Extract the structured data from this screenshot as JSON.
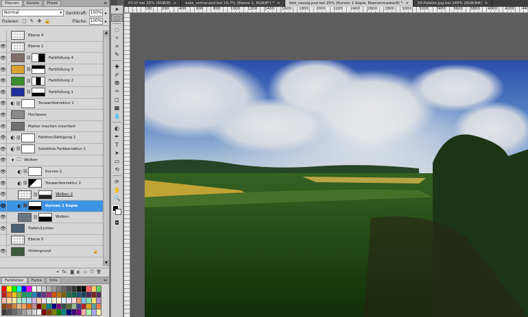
{
  "layers_panel": {
    "tabs": [
      "Ebenen",
      "Kanäle",
      "Pfade"
    ],
    "menu_icon": "panel-menu-icon",
    "blend_mode": "Normal",
    "opacity_label": "Deckkraft:",
    "opacity_value": "100%",
    "lock_label": "Fixieren:",
    "fill_label": "Fläche:",
    "fill_value": "100%",
    "layers": [
      {
        "name": "Ebene 4",
        "visible": false,
        "indent": 0,
        "thumb": "checker",
        "style": ""
      },
      {
        "name": "Ebene 1",
        "visible": true,
        "indent": 0,
        "thumb": "checker",
        "style": ""
      },
      {
        "name": "Farbfüllung 4",
        "visible": true,
        "indent": 0,
        "thumb": "#7e6e6a",
        "mask": "mask-a",
        "style": ""
      },
      {
        "name": "Farbfüllung 3",
        "visible": true,
        "indent": 0,
        "thumb": "#d8a531",
        "mask": "mask-b",
        "style": ""
      },
      {
        "name": "Farbfüllung 2",
        "visible": true,
        "indent": 0,
        "thumb": "#3a8f2c",
        "mask": "mask-c",
        "style": ""
      },
      {
        "name": "Farbfüllung 1",
        "visible": true,
        "indent": 0,
        "thumb": "#1b2f9d",
        "mask": "mask-d",
        "style": ""
      },
      {
        "name": "Tonwertkorrektur 1",
        "visible": true,
        "indent": 0,
        "adj": true,
        "mask": "white",
        "style": ""
      },
      {
        "name": "Hochpass",
        "visible": true,
        "indent": 0,
        "thumb": "#8a8a8a",
        "style": ""
      },
      {
        "name": "Matter machen invertiert",
        "visible": true,
        "indent": 0,
        "thumb": "#707070",
        "style": ""
      },
      {
        "name": "Farbton/Sättigung 1",
        "visible": true,
        "indent": 0,
        "adj": true,
        "mask": "white",
        "style": ""
      },
      {
        "name": "Selektive Farbkorrektur 1",
        "visible": true,
        "indent": 0,
        "adj": true,
        "mask": "white",
        "style": ""
      },
      {
        "name": "Wolken",
        "visible": true,
        "indent": 0,
        "group": true,
        "style": ""
      },
      {
        "name": "Kurven 1",
        "visible": true,
        "indent": 1,
        "adj": true,
        "mask": "white",
        "style": ""
      },
      {
        "name": "Tonwertkorrektur 2",
        "visible": true,
        "indent": 1,
        "adj": true,
        "mask": "mask-e",
        "style": ""
      },
      {
        "name": "Wolken 2",
        "visible": true,
        "indent": 1,
        "thumb": "checker",
        "mask": "mask-f",
        "style": "u"
      },
      {
        "name": "Kurven 1 Kopie",
        "visible": true,
        "indent": 1,
        "adj": true,
        "mask": "mask-g",
        "selected": true,
        "style": ""
      },
      {
        "name": "Wolken",
        "visible": true,
        "indent": 1,
        "thumb": "#6a7580",
        "mask": "mask-h",
        "style": ""
      },
      {
        "name": "Tiefen/Lichter",
        "visible": true,
        "indent": 0,
        "thumb": "#4a6074",
        "style": ""
      },
      {
        "name": "Ebene 5",
        "visible": false,
        "indent": 0,
        "thumb": "checker",
        "style": ""
      },
      {
        "name": "Hintergrund",
        "visible": true,
        "indent": 0,
        "thumb": "#3c5a3a",
        "style": "it",
        "locked": true
      }
    ],
    "bottom_icons": [
      "link-icon",
      "fx-icon",
      "mask-icon",
      "adjust-icon",
      "folder-icon",
      "new-layer-icon",
      "trash-icon"
    ]
  },
  "swatches_panel": {
    "tabs": [
      "Farbfelder",
      "Farbe",
      "Stile"
    ],
    "colors": [
      "#ff0000",
      "#ffff00",
      "#00ff00",
      "#00ffff",
      "#0000ff",
      "#ff00ff",
      "#ffffff",
      "#e6e6e6",
      "#cccccc",
      "#b3b3b3",
      "#999999",
      "#808080",
      "#666666",
      "#4d4d4d",
      "#333333",
      "#1a1a1a",
      "#000000",
      "#ff6666",
      "#ffcc66",
      "#66cc66",
      "#c21a1a",
      "#e67e22",
      "#f1c40f",
      "#7dbb3c",
      "#1e9b5a",
      "#16a085",
      "#2980b9",
      "#2c3e90",
      "#6c3483",
      "#a5296f",
      "#d35400",
      "#b9770e",
      "#7d6608",
      "#1d6f42",
      "#0e6655",
      "#1b4f72",
      "#154360",
      "#4a235a",
      "#78281f",
      "#512e5f",
      "#f5b7b1",
      "#fad7a0",
      "#f9e79f",
      "#abebc6",
      "#a3e4d7",
      "#aed6f1",
      "#d2b4de",
      "#f5cba7",
      "#e8daef",
      "#d5f5e3",
      "#fdebd0",
      "#fcf3cf",
      "#d6eaf8",
      "#ebdef0",
      "#fadbd8",
      "#e59866",
      "#85c1e9",
      "#82e0aa",
      "#f7dc6f",
      "#bb8fce",
      "#8b4513",
      "#a0522d",
      "#cd853f",
      "#deb887",
      "#f4a460",
      "#d2691e",
      "#bc8f8f",
      "#800000",
      "#808000",
      "#008080",
      "#000080",
      "#800080",
      "#2f4f4f",
      "#556b2f",
      "#8fbc8f",
      "#483d8b",
      "#b22222",
      "#daa520",
      "#5f9ea0",
      "#ff7f50",
      "#3a3a3a",
      "#505050",
      "#6a6a6a",
      "#858585",
      "#a0a0a0",
      "#bababa",
      "#d4d4d4",
      "#efefef",
      "#7f0000",
      "#7f3f00",
      "#7f7f00",
      "#007f00",
      "#007f7f",
      "#00007f",
      "#3f007f",
      "#7f007f",
      "#ffaaaa",
      "#aaffaa",
      "#aaaaff",
      "#ffffaa"
    ]
  },
  "document_tabs": [
    {
      "label": "03.tif bei 25% (RGB/8)",
      "active": false
    },
    {
      "label": "kate_vorher.psd bei 16,7% (Ebene 1, RGB/8*) *",
      "active": false
    },
    {
      "label": "feld_nassig.psd bei 25% (Kurven 1 Kopie, Ebenenmaske/8) *",
      "active": false
    },
    {
      "label": "05-Palette.jpg bei 189% (RGB/8#)",
      "active": false
    }
  ],
  "active_tab_index": 2,
  "ruler_numbers": [
    "100",
    "200",
    "400",
    "600",
    "800",
    "1000",
    "1200",
    "1400",
    "1600",
    "1800",
    "2000",
    "2200",
    "2400",
    "2600",
    "2800",
    "3000",
    "3200",
    "3400",
    "3600",
    "3800",
    "4000",
    "4200",
    "4400"
  ],
  "tools": [
    "move-icon",
    "marquee-icon",
    "lasso-icon",
    "quick-select-icon",
    "crop-icon",
    "eyedropper-icon",
    "healing-icon",
    "brush-icon",
    "stamp-icon",
    "history-brush-icon",
    "eraser-icon",
    "gradient-icon",
    "blur-icon",
    "dodge-icon",
    "pen-icon",
    "type-icon",
    "path-select-icon",
    "shape-icon",
    "3d-rotate-icon",
    "3d-orbit-icon",
    "hand-icon",
    "zoom-icon"
  ],
  "tool_glyphs": [
    "➤",
    "⬚",
    "◌",
    "✧",
    "⌗",
    "✎",
    "✚",
    "✐",
    "⛃",
    "✑",
    "◻",
    "▦",
    "💧",
    "◐",
    "✒",
    "T",
    "➤",
    "▭",
    "⟲",
    "⟳",
    "✋",
    "🔍"
  ],
  "colors": {
    "foreground": "#000000",
    "background": "#ffffff",
    "selection": "#3e94e4"
  }
}
